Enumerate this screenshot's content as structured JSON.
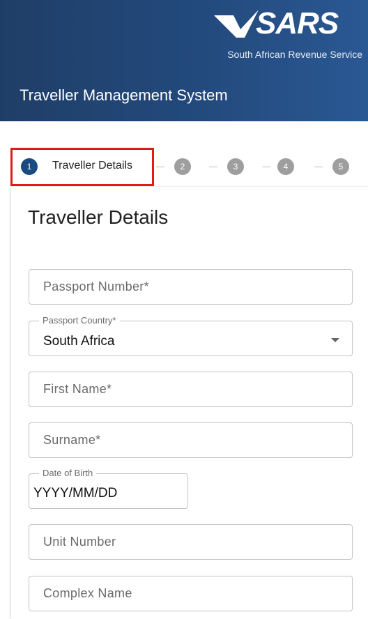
{
  "header": {
    "logo_text": "SARS",
    "organization": "South African Revenue Service",
    "app_title": "Traveller Management System"
  },
  "stepper": {
    "steps": [
      {
        "number": "1",
        "label": "Traveller Details",
        "active": true
      },
      {
        "number": "2"
      },
      {
        "number": "3"
      },
      {
        "number": "4"
      },
      {
        "number": "5"
      }
    ]
  },
  "form": {
    "title": "Traveller Details",
    "passport_number": {
      "placeholder": "Passport Number*"
    },
    "passport_country": {
      "label": "Passport Country*",
      "value": "South Africa"
    },
    "first_name": {
      "placeholder": "First Name*"
    },
    "surname": {
      "placeholder": "Surname*"
    },
    "date_of_birth": {
      "label": "Date of Birth",
      "value": "YYYY/MM/DD"
    },
    "unit_number": {
      "placeholder": "Unit Number"
    },
    "complex_name": {
      "placeholder": "Complex Name"
    }
  },
  "colors": {
    "header": "#234a7d",
    "active_step": "#1a4a82",
    "inactive_step": "#9e9e9e",
    "highlight": "#e21a1a"
  }
}
